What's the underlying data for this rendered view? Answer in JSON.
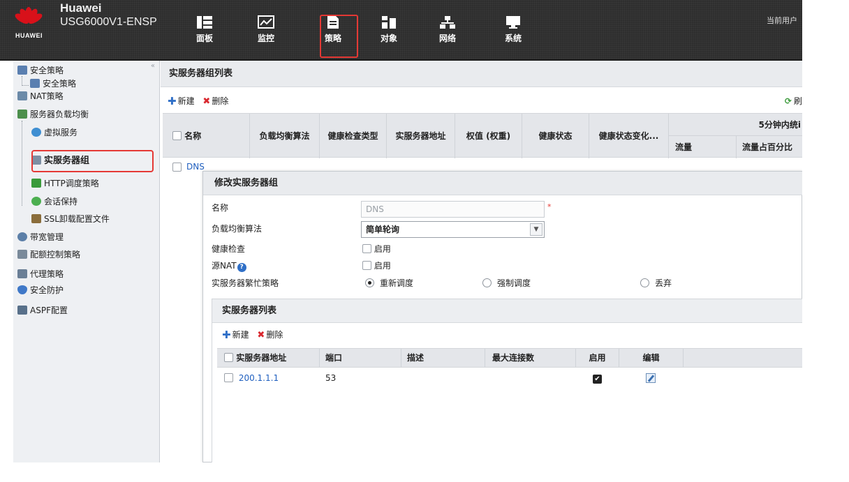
{
  "header": {
    "brand": "Huawei",
    "model": "USG6000V1-ENSP",
    "logo_text": "HUAWEI",
    "current_user": "当前用户",
    "nav": [
      {
        "label": "面板",
        "icon": "dashboard-icon"
      },
      {
        "label": "监控",
        "icon": "monitor-icon"
      },
      {
        "label": "策略",
        "icon": "policy-icon"
      },
      {
        "label": "对象",
        "icon": "object-icon"
      },
      {
        "label": "网络",
        "icon": "network-icon"
      },
      {
        "label": "系统",
        "icon": "system-icon"
      }
    ]
  },
  "sidebar": {
    "items": [
      {
        "label": "安全策略"
      },
      {
        "label": "安全策略"
      },
      {
        "label": "NAT策略"
      },
      {
        "label": "服务器负载均衡"
      },
      {
        "label": "虚拟服务"
      },
      {
        "label": "实服务器组"
      },
      {
        "label": "HTTP调度策略"
      },
      {
        "label": "会话保持"
      },
      {
        "label": "SSL卸载配置文件"
      },
      {
        "label": "带宽管理"
      },
      {
        "label": "配额控制策略"
      },
      {
        "label": "代理策略"
      },
      {
        "label": "安全防护"
      },
      {
        "label": "ASPF配置"
      }
    ]
  },
  "main": {
    "title": "实服务器组列表",
    "toolbar": {
      "new": "新建",
      "delete": "删除",
      "refresh": "刷"
    },
    "columns": {
      "name": "名称",
      "algorithm": "负载均衡算法",
      "health_type": "健康检查类型",
      "server_addr": "实服务器地址",
      "weight": "权值 (权重)",
      "health_status": "健康状态",
      "health_change": "健康状态变化...",
      "stats_group": "5分钟内统i",
      "traffic": "流量",
      "traffic_pct": "流量占百分比"
    },
    "row": {
      "name": "DNS"
    }
  },
  "dialog": {
    "title": "修改实服务器组",
    "fields": {
      "name_label": "名称",
      "name_value": "DNS",
      "algorithm_label": "负载均衡算法",
      "algorithm_value": "简单轮询",
      "health_label": "健康检查",
      "health_check_text": "启用",
      "snat_label": "源NAT",
      "snat_check_text": "启用",
      "busy_label": "实服务器繁忙策略",
      "busy_options": [
        "重新调度",
        "强制调度",
        "丢弃"
      ],
      "busy_selected": "重新调度"
    },
    "server_list": {
      "title": "实服务器列表",
      "toolbar": {
        "new": "新建",
        "delete": "删除"
      },
      "columns": {
        "address": "实服务器地址",
        "port": "端口",
        "desc": "描述",
        "max_conn": "最大连接数",
        "enabled": "启用",
        "edit": "编辑"
      },
      "rows": [
        {
          "address": "200.1.1.1",
          "port": "53",
          "desc": "",
          "max_conn": "",
          "enabled": true
        }
      ]
    }
  }
}
